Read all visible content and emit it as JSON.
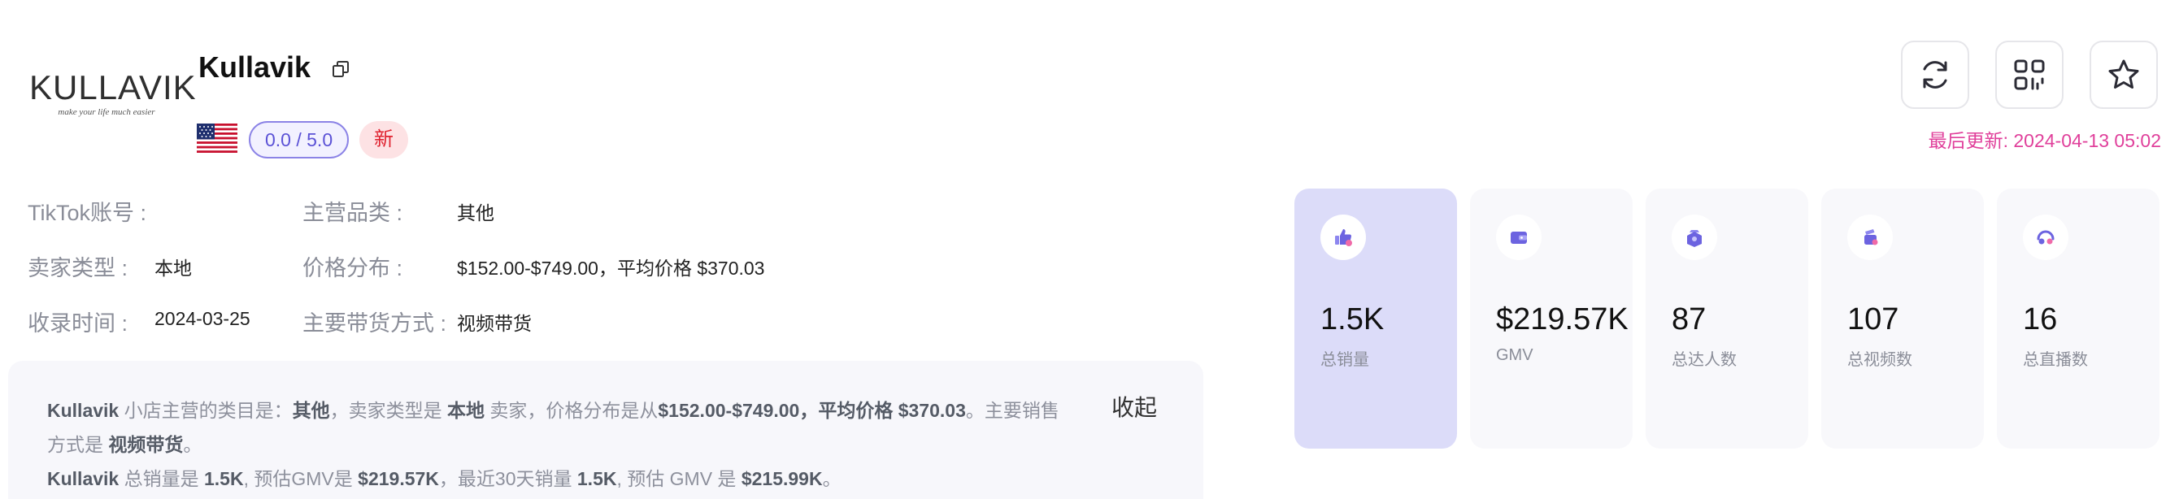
{
  "shop": {
    "name": "Kullavik",
    "logo_text": "KULLAVIK",
    "logo_tagline": "make your life much easier",
    "rating": "0.0 / 5.0",
    "badge": "新"
  },
  "last_updated": "最后更新: 2024-04-13 05:02",
  "info": {
    "tiktok_label": "TikTok账号 :",
    "tiktok_value": "",
    "seller_type_label": "卖家类型 :",
    "seller_type_value": "本地",
    "recorded_label": "收录时间 :",
    "recorded_value": "2024-03-25",
    "category_label": "主营品类 :",
    "category_value": "其他",
    "price_label": "价格分布 :",
    "price_value": "$152.00-$749.00，平均价格 $370.03",
    "sales_mode_label": "主要带货方式 :",
    "sales_mode_value": "视频带货"
  },
  "summary": {
    "shop": "Kullavik",
    "t1": " 小店主营的类目是：",
    "category": "其他",
    "t2": "，卖家类型是 ",
    "seller_type": "本地",
    "t3": " 卖家，价格分布是从",
    "price_range": "$152.00-$749.00，平均价格 $370.03",
    "t4": "。主要销售",
    "t5": "方式是 ",
    "mode": "视频带货",
    "t6": "。",
    "shop2": "Kullavik",
    "t7": " 总销量是 ",
    "sales": "1.5K",
    "t8": ", 预估GMV是 ",
    "gmv": "$219.57K",
    "t9": "，最近30天销量 ",
    "sales30": "1.5K",
    "t10": ", 预估 GMV 是 ",
    "gmv30": "$215.99K",
    "t11": "。",
    "collapse_label": "收起"
  },
  "stats": [
    {
      "value": "1.5K",
      "label": "总销量",
      "icon": "thumbs-up-icon"
    },
    {
      "value": "$219.57K",
      "label": "GMV",
      "icon": "wallet-icon"
    },
    {
      "value": "87",
      "label": "总达人数",
      "icon": "influencer-icon"
    },
    {
      "value": "107",
      "label": "总视频数",
      "icon": "video-icon"
    },
    {
      "value": "16",
      "label": "总直播数",
      "icon": "live-icon"
    }
  ],
  "colors": {
    "accent": "#5b52d6",
    "updated": "#e0409b",
    "active_card": "#dcdcf9"
  }
}
